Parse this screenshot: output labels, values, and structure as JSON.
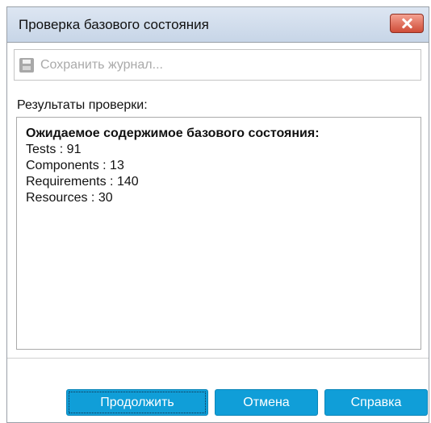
{
  "window": {
    "title": "Проверка базового состояния"
  },
  "toolbar": {
    "save_log_label": "Сохранить журнал..."
  },
  "results": {
    "section_label": "Результаты проверки:",
    "heading": "Ожидаемое содержимое базового состояния:",
    "rows": [
      "Tests : 91",
      "Components : 13",
      "Requirements : 140",
      "Resources : 30"
    ]
  },
  "buttons": {
    "continue": "Продолжить",
    "cancel": "Отмена",
    "help": "Справка"
  },
  "colors": {
    "primary_button": "#109ed8",
    "close_button": "#cf4c38",
    "title_bar": "#c7d5e7"
  },
  "icons": {
    "save": "save-icon",
    "close": "close-icon"
  }
}
